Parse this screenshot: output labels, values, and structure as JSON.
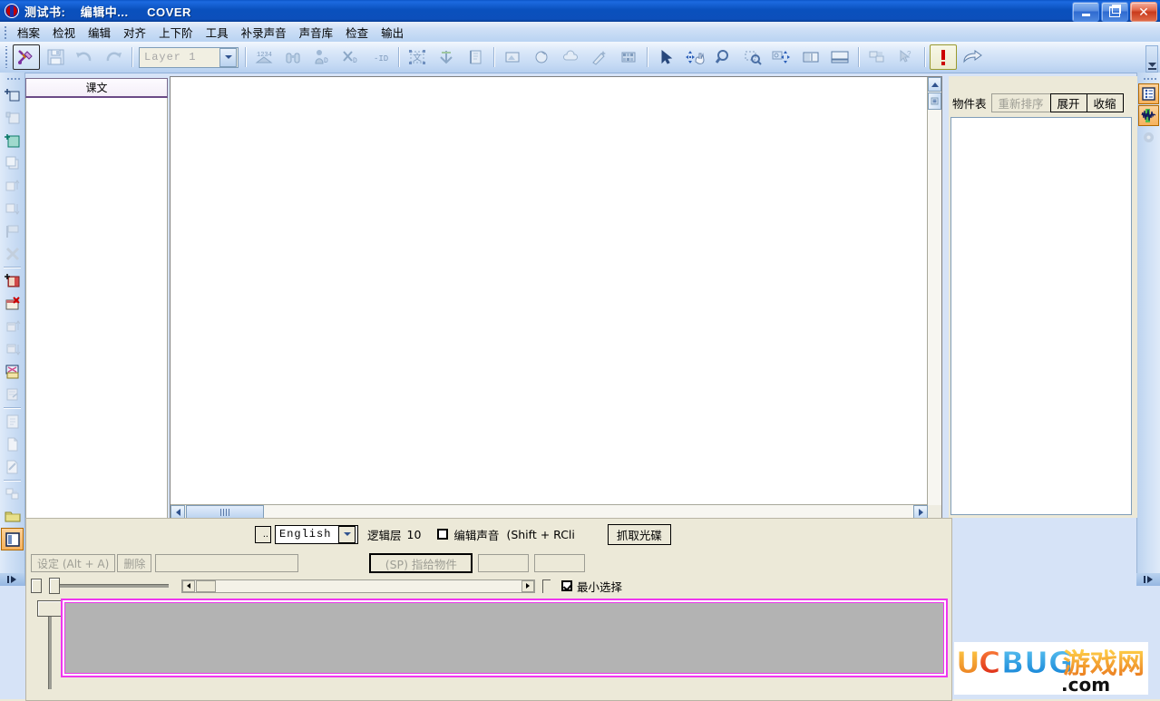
{
  "window": {
    "title": "测试书:    编辑中...     COVER",
    "icon": "app-logo-icon",
    "buttons": {
      "minimize": "minimize",
      "restore": "restore",
      "close": "close"
    }
  },
  "menubar": {
    "items": [
      {
        "label": "档案"
      },
      {
        "label": "检视"
      },
      {
        "label": "编辑"
      },
      {
        "label": "对齐"
      },
      {
        "label": "上下阶"
      },
      {
        "label": "工具"
      },
      {
        "label": "补录声音"
      },
      {
        "label": "声音库"
      },
      {
        "label": "检查"
      },
      {
        "label": "输出"
      }
    ]
  },
  "toolbar": {
    "layer_value": "Layer 1",
    "buttons": [
      {
        "name": "tools-icon",
        "state": "selected"
      },
      {
        "name": "save-icon",
        "state": "disabled"
      },
      {
        "name": "undo-icon",
        "state": "disabled"
      },
      {
        "name": "redo-icon",
        "state": "disabled"
      },
      {
        "name": "numbering-icon",
        "state": "disabled"
      },
      {
        "name": "binoculars-icon",
        "state": "disabled"
      },
      {
        "name": "person-3d-icon",
        "state": "disabled"
      },
      {
        "name": "cut-3d-icon",
        "state": "disabled"
      },
      {
        "name": "id-icon",
        "state": "disabled"
      },
      {
        "name": "text-box-icon",
        "state": "disabled"
      },
      {
        "name": "anchor-icon",
        "state": "disabled"
      },
      {
        "name": "page-icon",
        "state": "disabled"
      },
      {
        "name": "frame-icon",
        "state": "disabled"
      },
      {
        "name": "circle-shape-icon",
        "state": "disabled"
      },
      {
        "name": "cloud-shape-icon",
        "state": "disabled"
      },
      {
        "name": "magic-wand-icon",
        "state": "disabled"
      },
      {
        "name": "film-icon",
        "state": "disabled"
      },
      {
        "name": "pointer-icon",
        "state": "normal"
      },
      {
        "name": "move-hand-icon",
        "state": "normal"
      },
      {
        "name": "zoom-icon",
        "state": "normal"
      },
      {
        "name": "zoom-region-icon",
        "state": "normal"
      },
      {
        "name": "pan-region-icon",
        "state": "normal"
      },
      {
        "name": "split-view-icon",
        "state": "normal"
      },
      {
        "name": "single-view-icon",
        "state": "normal"
      },
      {
        "name": "arrange-icon",
        "state": "disabled"
      },
      {
        "name": "help-pointer-icon",
        "state": "disabled"
      },
      {
        "name": "alert-icon",
        "state": "warning"
      },
      {
        "name": "export-icon",
        "state": "normal"
      }
    ]
  },
  "left_toolbar": {
    "buttons": [
      {
        "name": "add-page-icon",
        "state": "normal"
      },
      {
        "name": "insert-page-icon",
        "state": "disabled"
      },
      {
        "name": "new-page-icon",
        "state": "normal"
      },
      {
        "name": "copy-page-icon",
        "state": "disabled"
      },
      {
        "name": "move-page-up-icon",
        "state": "disabled"
      },
      {
        "name": "move-page-down-icon",
        "state": "disabled"
      },
      {
        "name": "page-flag-icon",
        "state": "disabled"
      },
      {
        "name": "delete-page-icon",
        "state": "disabled"
      },
      {
        "name": "add-chapter-icon",
        "state": "normal"
      },
      {
        "name": "remove-chapter-icon",
        "state": "normal"
      },
      {
        "name": "chapter-up-icon",
        "state": "disabled"
      },
      {
        "name": "chapter-down-icon",
        "state": "disabled"
      },
      {
        "name": "book-layout-icon",
        "state": "normal"
      },
      {
        "name": "page-props-icon",
        "state": "disabled"
      },
      {
        "name": "clipboard-icon",
        "state": "disabled"
      },
      {
        "name": "document-icon",
        "state": "disabled"
      },
      {
        "name": "edit-doc-icon",
        "state": "disabled"
      },
      {
        "name": "duplicate-icon",
        "state": "disabled"
      },
      {
        "name": "folder-icon",
        "state": "normal"
      },
      {
        "name": "panel-toggle-icon",
        "state": "selected"
      }
    ],
    "overflow": "more-tools-icon"
  },
  "right_toolbar": {
    "buttons": [
      {
        "name": "object-list-icon",
        "state": "selected"
      },
      {
        "name": "waveform-icon",
        "state": "selected"
      },
      {
        "name": "settings-icon",
        "state": "disabled"
      }
    ],
    "overflow": "more-tools-icon"
  },
  "page_panel": {
    "tab_label": "课文"
  },
  "object_panel": {
    "title": "物件表",
    "buttons": [
      {
        "label": "重新排序",
        "state": "disabled"
      },
      {
        "label": "展开",
        "state": "normal"
      },
      {
        "label": "收缩",
        "state": "normal"
      }
    ]
  },
  "bottom_bar": {
    "ellipsis_button": "..",
    "language_value": "English",
    "layer_label": "逻辑层",
    "layer_value": "10",
    "edit_sound_label": "编辑声音",
    "edit_sound_checked": false,
    "shortcut_hint": "(Shift + RCli",
    "grab_disc_button": "抓取光碟",
    "set_button": "设定 (Alt + A)",
    "delete_button": "删除",
    "assign_button": "(SP) 指给物件",
    "text_field_value": "",
    "small_field_1": "",
    "small_field_2": "",
    "min_select_label": "最小选择",
    "min_select_checked": true,
    "waveform_area": "waveform-display"
  },
  "watermark": {
    "part1": "UC",
    "part2": "BUG",
    "part3": "游戏网",
    "part4": ".com"
  },
  "colors": {
    "titlebar_blue": "#0b55c6",
    "accent_orange": "#f6b25d",
    "waveform_border": "#ef35ef",
    "waveform_fill": "#b3b3b3",
    "panel_beige": "#ece9d8",
    "tab_purple": "#6b4a86",
    "alert_red": "#cc0000"
  }
}
